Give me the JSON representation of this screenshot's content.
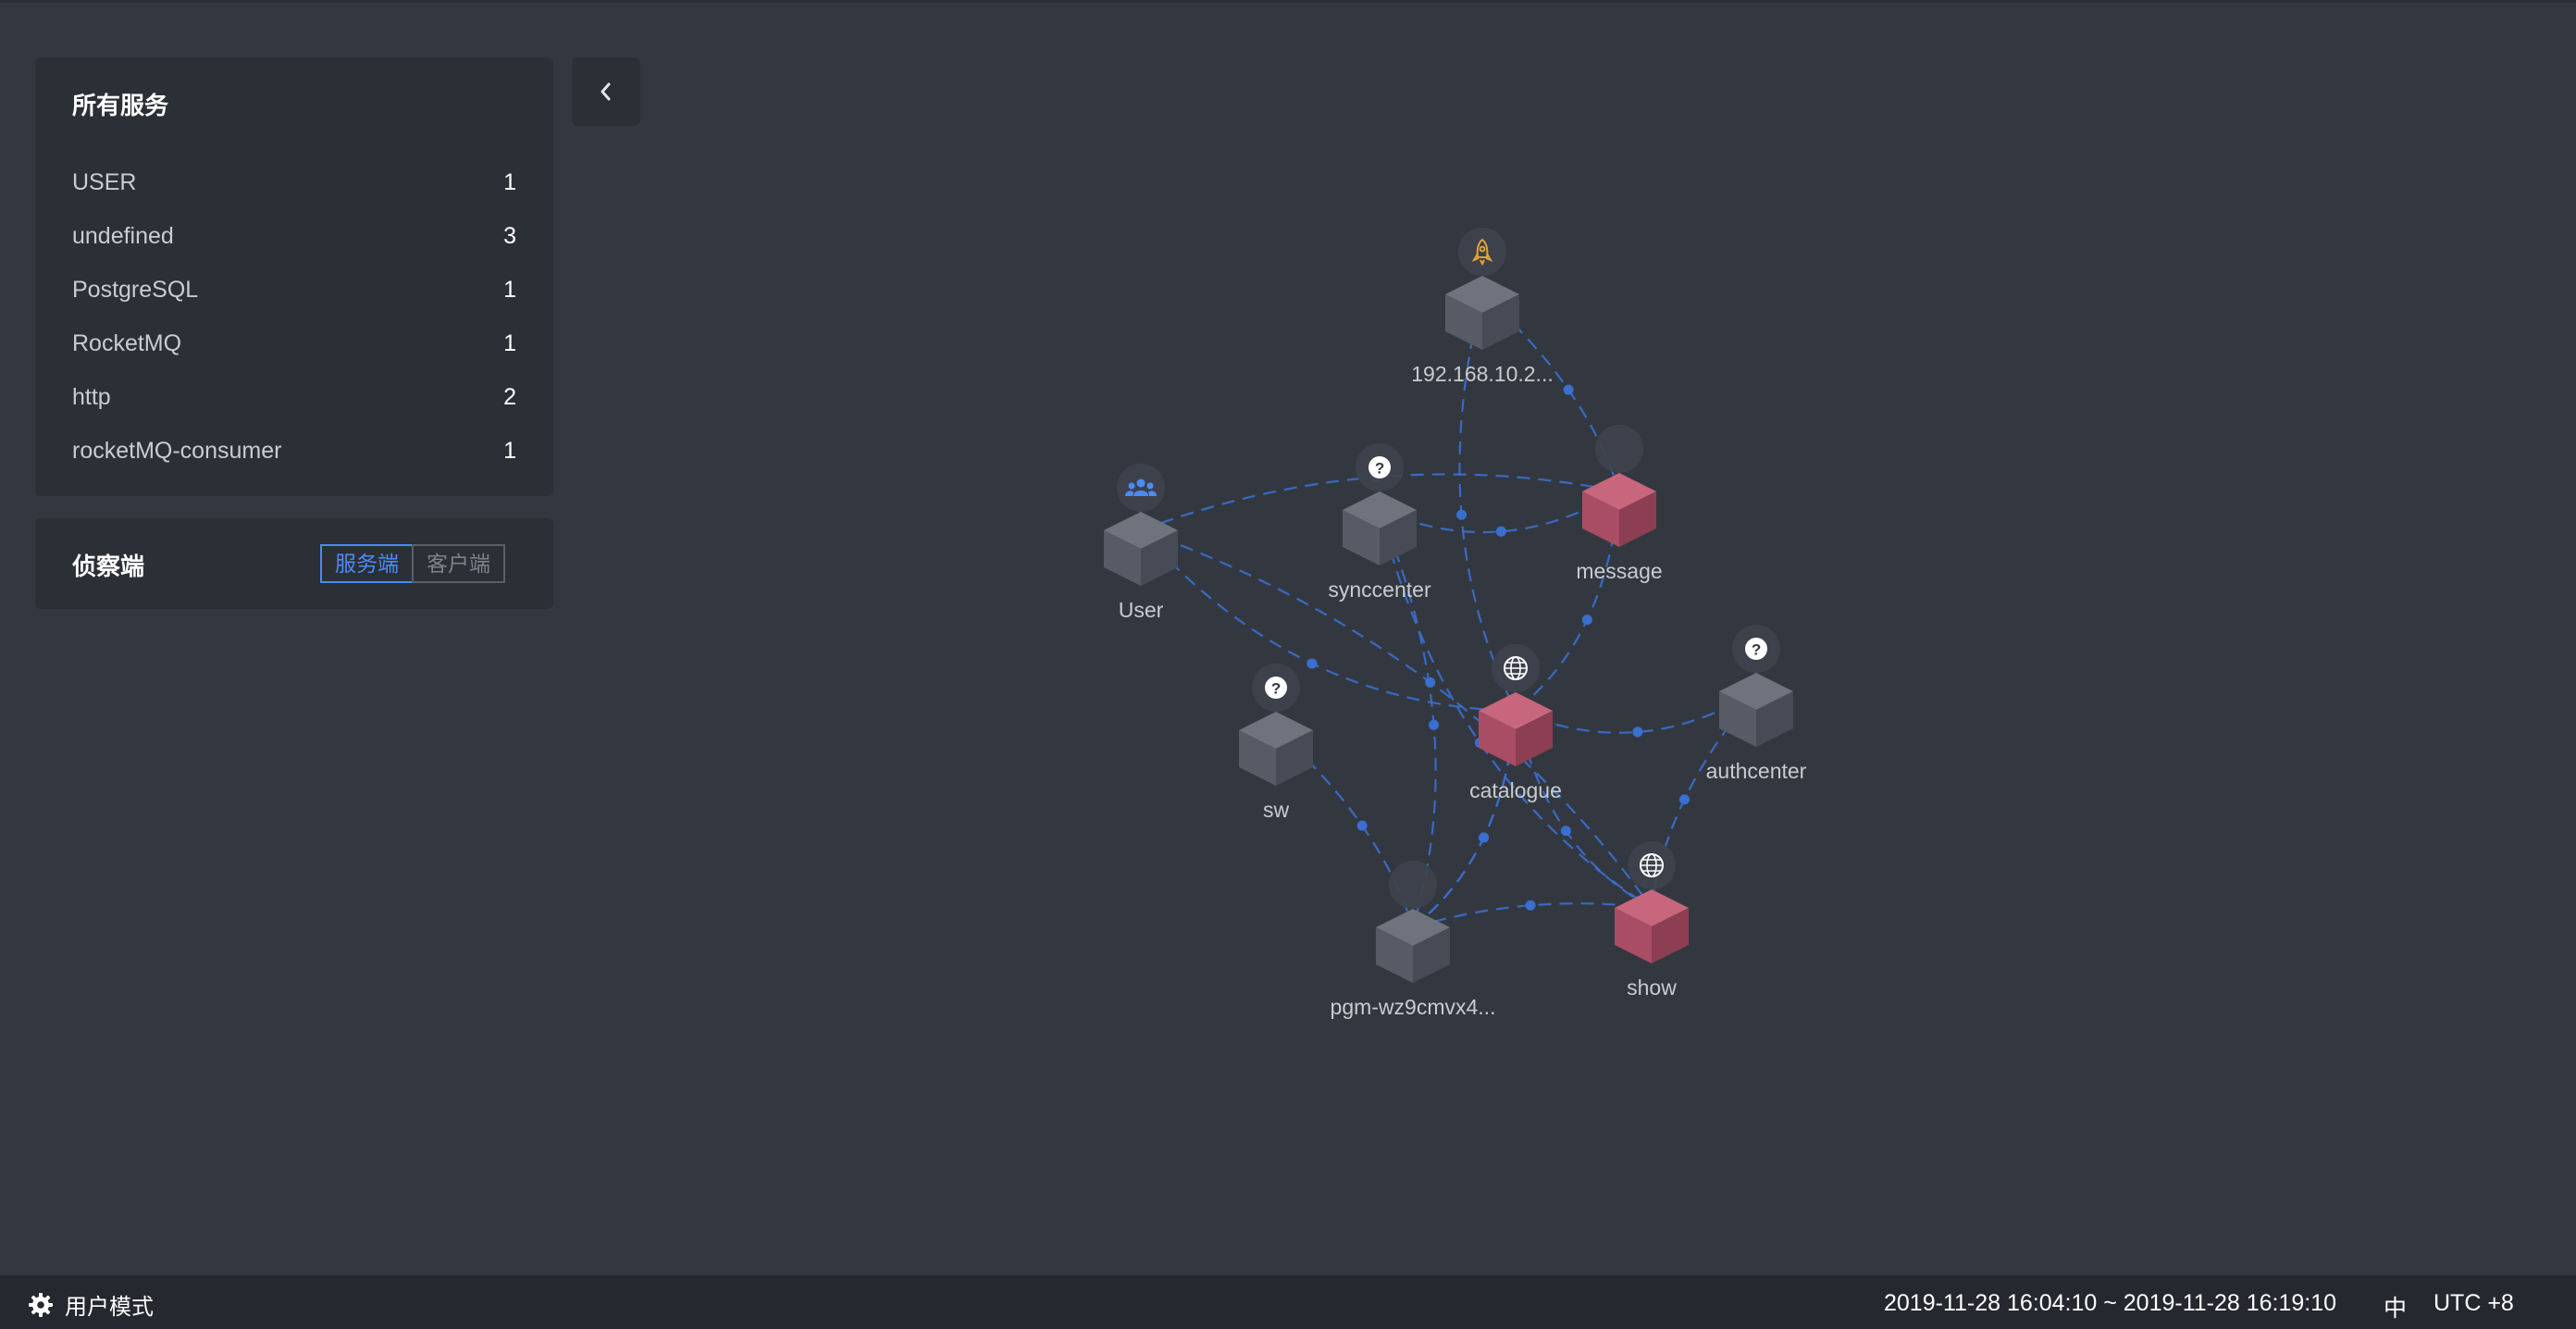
{
  "services_panel": {
    "title": "所有服务",
    "items": [
      {
        "name": "USER",
        "count": "1"
      },
      {
        "name": "undefined",
        "count": "3"
      },
      {
        "name": "PostgreSQL",
        "count": "1"
      },
      {
        "name": "RocketMQ",
        "count": "1"
      },
      {
        "name": "http",
        "count": "2"
      },
      {
        "name": "rocketMQ-consumer",
        "count": "1"
      }
    ]
  },
  "detector_panel": {
    "title": "侦察端",
    "options": [
      "服务端",
      "客户端"
    ],
    "selected": "服务端"
  },
  "topology": {
    "nodes": [
      {
        "id": "ip",
        "label": "192.168.10.2...",
        "icon": "rocket-icon",
        "color": "gray"
      },
      {
        "id": "user",
        "label": "User",
        "icon": "users-icon",
        "color": "gray"
      },
      {
        "id": "synccenter",
        "label": "synccenter",
        "icon": "question-icon",
        "color": "gray"
      },
      {
        "id": "message",
        "label": "message",
        "icon": "none",
        "color": "red"
      },
      {
        "id": "catalogue",
        "label": "catalogue",
        "icon": "globe-icon",
        "color": "red"
      },
      {
        "id": "sw",
        "label": "sw",
        "icon": "question-icon",
        "color": "gray"
      },
      {
        "id": "authcenter",
        "label": "authcenter",
        "icon": "question-icon",
        "color": "gray"
      },
      {
        "id": "pgm",
        "label": "pgm-wz9cmvx4...",
        "icon": "none",
        "color": "gray"
      },
      {
        "id": "show",
        "label": "show",
        "icon": "globe-icon",
        "color": "red"
      }
    ],
    "edges": [
      [
        "ip",
        "message"
      ],
      [
        "ip",
        "catalogue"
      ],
      [
        "user",
        "message"
      ],
      [
        "user",
        "catalogue"
      ],
      [
        "user",
        "show"
      ],
      [
        "synccenter",
        "message"
      ],
      [
        "synccenter",
        "pgm"
      ],
      [
        "synccenter",
        "show"
      ],
      [
        "message",
        "catalogue"
      ],
      [
        "catalogue",
        "authcenter"
      ],
      [
        "catalogue",
        "pgm"
      ],
      [
        "catalogue",
        "show"
      ],
      [
        "sw",
        "pgm"
      ],
      [
        "authcenter",
        "show"
      ],
      [
        "pgm",
        "show"
      ],
      [
        "pgm",
        "catalogue"
      ]
    ],
    "colors": {
      "edge": "#3a6fd0",
      "node_gray": "#5b606b",
      "node_red": "#b5556c"
    }
  },
  "footer": {
    "mode_label": "用户模式",
    "time_range": "2019-11-28 16:04:10 ~ 2019-11-28 16:19:10",
    "language": "中",
    "timezone": "UTC +8"
  }
}
